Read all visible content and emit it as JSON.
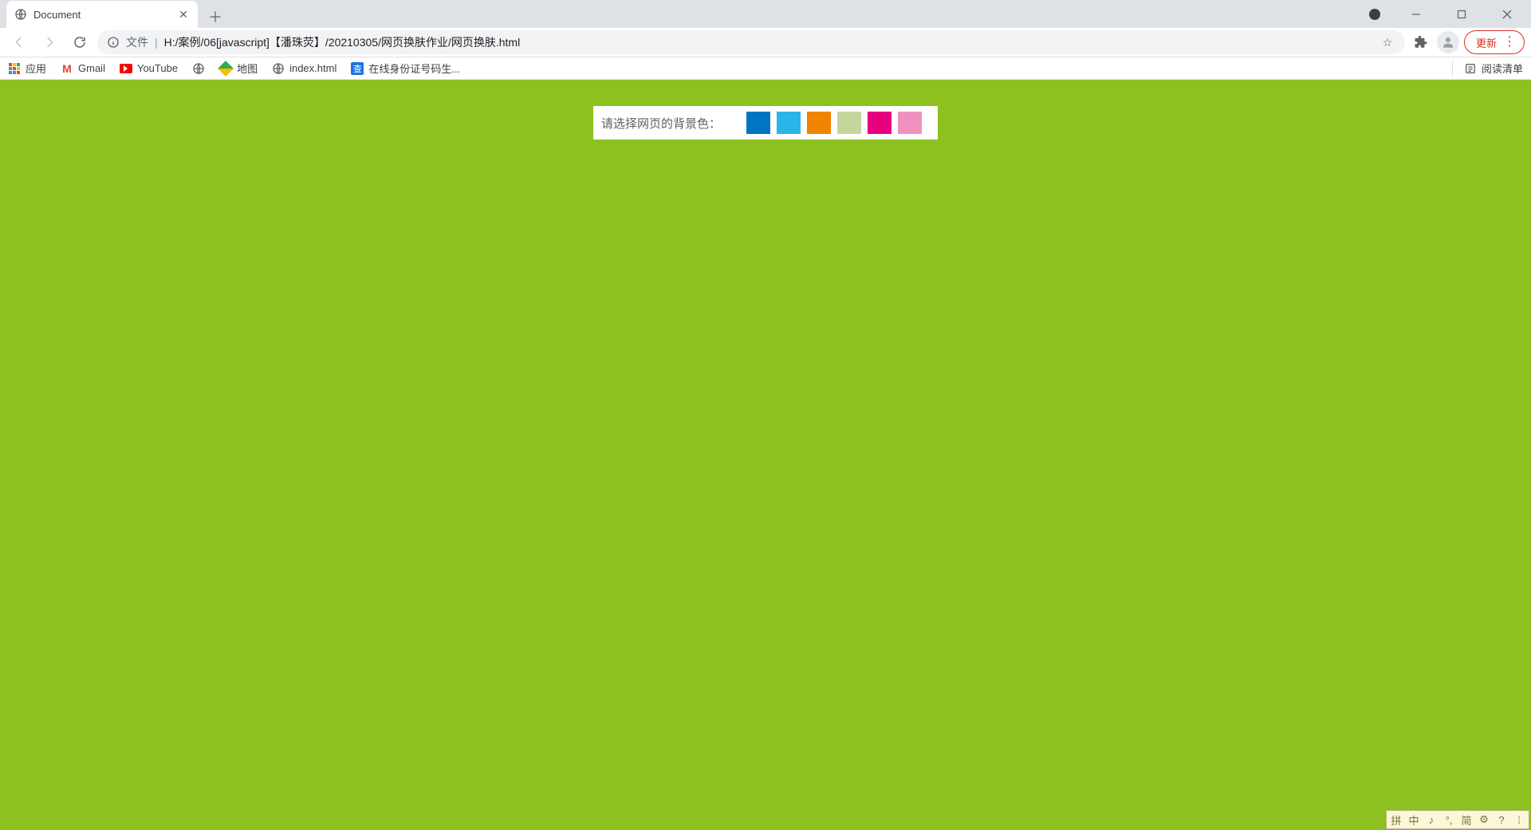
{
  "browser": {
    "tab_title": "Document",
    "address": {
      "scheme_label": "文件",
      "url_path": "H:/案例/06[javascript]【潘珠荧】/20210305/网页换肤作业/网页换肤.html"
    },
    "update_label": "更新",
    "bookmarks": {
      "apps": "应用",
      "gmail": "Gmail",
      "youtube": "YouTube",
      "maps": "地图",
      "index": "index.html",
      "idgen": "在线身份证号码生...",
      "reading_list": "阅读清单"
    }
  },
  "page": {
    "background_color": "#8cc11f",
    "panel_label": "请选择网页的背景色：",
    "swatches": [
      {
        "name": "blue",
        "color": "#0075c1"
      },
      {
        "name": "sky-blue",
        "color": "#29b6e6"
      },
      {
        "name": "orange",
        "color": "#f08300"
      },
      {
        "name": "light-olive",
        "color": "#c4d69b"
      },
      {
        "name": "magenta",
        "color": "#e4007f"
      },
      {
        "name": "pink",
        "color": "#ef91be"
      }
    ]
  },
  "ime": {
    "items": [
      "拼",
      "中",
      "♪",
      "°,",
      "简",
      "⚙",
      "?",
      "⁞"
    ]
  }
}
